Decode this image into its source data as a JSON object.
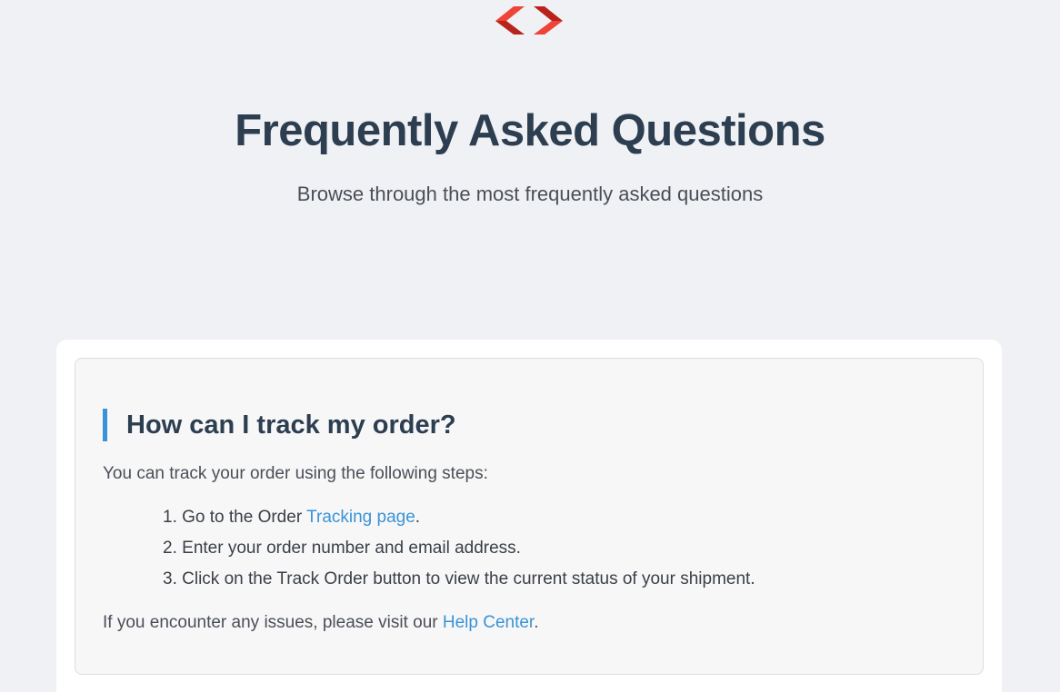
{
  "brand": {
    "logo_icon": "code-brackets-logo",
    "logo_color": "#e8392f"
  },
  "hero": {
    "title": "Frequently Asked Questions",
    "subtitle": "Browse through the most frequently asked questions"
  },
  "faq": {
    "items": [
      {
        "question": "How can I track my order?",
        "intro": "You can track your order using the following steps:",
        "steps": [
          {
            "number": "1.",
            "text_before": "Go to the Order",
            "link_text": "Tracking page",
            "text_after": "."
          },
          {
            "number": "2.",
            "text": "Enter your order number and email address."
          },
          {
            "number": "3.",
            "text": "Click on the Track Order button to view the current status of your shipment."
          }
        ],
        "outro_before": "If you encounter any issues, please visit our",
        "outro_link": "Help Center",
        "outro_after": "."
      }
    ]
  },
  "colors": {
    "background": "#f0f1f5",
    "heading": "#2c3e50",
    "accent": "#3a93d6"
  }
}
